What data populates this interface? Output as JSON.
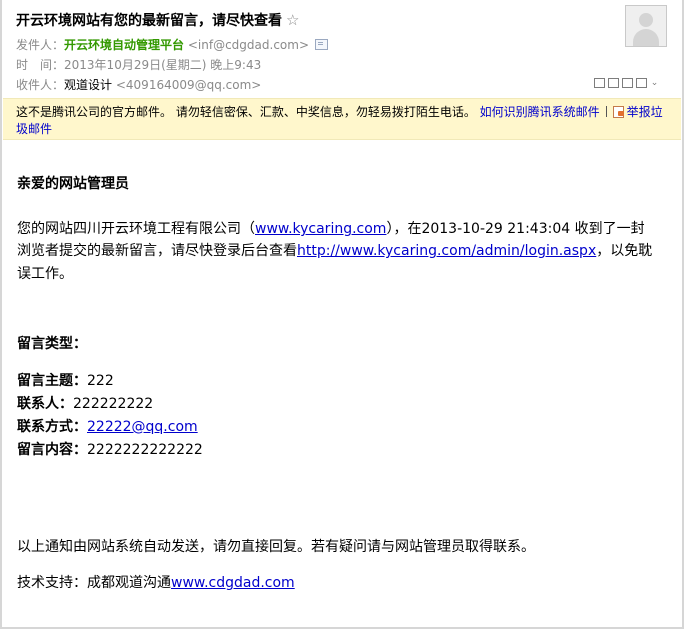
{
  "header": {
    "subject": "开云环境网站有您的最新留言，请尽快查看",
    "star_icon": "☆",
    "sender_label": "发件人：",
    "sender_name": "开云环境自动管理平台",
    "sender_email": "<inf@cdgdad.com>",
    "time_label": "时　间：",
    "time_value": "2013年10月29日(星期二) 晚上9:43",
    "recipient_label": "收件人：",
    "recipient_name": "观道设计",
    "recipient_email": "<409164009@qq.com>",
    "tool_icons": [
      "window-icon",
      "copy-icon",
      "save-icon",
      "print-icon",
      "expand-chevron-icon"
    ]
  },
  "warning": {
    "text": "这不是腾讯公司的官方邮件。 请勿轻信密保、汇款、中奖信息，勿轻易拨打陌生电话。",
    "link": "如何识别腾讯系统邮件",
    "report_part1": "举报垃",
    "report_part2": "圾邮件",
    "bg_color": "#fff7cc"
  },
  "body": {
    "greeting": "亲爱的网站管理员",
    "p1_prefix": "您的网站四川开云环境工程有限公司（",
    "p1_site": "www.kycaring.com",
    "p1_mid": "），在2013-10-29 21:43:04 收到了一封",
    "p2_prefix": "浏览者提交的最新留言，请尽快登录后台查看",
    "p2_link": "http://www.kycaring.com/admin/login.aspx",
    "p2_suffix": "，以免耽",
    "p3": "误工作。",
    "type_label": "留言类型：",
    "subject_label": "留言主题：",
    "subject_value": "222",
    "contact_label": "联系人：",
    "contact_value": "222222222",
    "method_label": "联系方式：",
    "method_value": "22222@qq.com",
    "content_label": "留言内容：",
    "content_value": "2222222222222",
    "footer_note": "以上通知由网站系统自动发送，请勿直接回复。若有疑问请与网站管理员取得联系。",
    "support_label": "技术支持：成都观道沟通",
    "support_link": "www.cdgdad.com"
  },
  "colors": {
    "sender_green": "#339900",
    "link_blue": "#0000cc",
    "meta_gray": "#8a8a8a"
  }
}
